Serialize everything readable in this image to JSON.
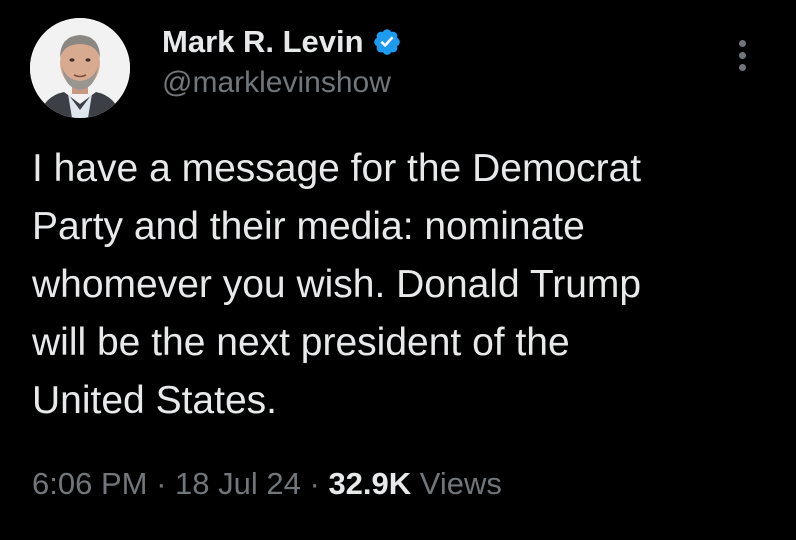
{
  "author": {
    "display_name": "Mark R. Levin",
    "handle": "@marklevinshow",
    "verified_icon": "verified-badge-icon",
    "verified_color": "#1d9bf0"
  },
  "more_icon": "more-vertical-icon",
  "tweet": {
    "lines": [
      "I have a message for the Democrat",
      "Party and their media: nominate",
      "whomever you wish.  Donald Trump",
      "will be the next president of the",
      "United States."
    ]
  },
  "meta": {
    "time": "6:06 PM",
    "separator": "·",
    "date": "18 Jul 24",
    "views_count": "32.9K",
    "views_label": "Views"
  },
  "colors": {
    "background": "#000000",
    "primary_text": "#e7e9ea",
    "secondary_text": "#71767b"
  }
}
